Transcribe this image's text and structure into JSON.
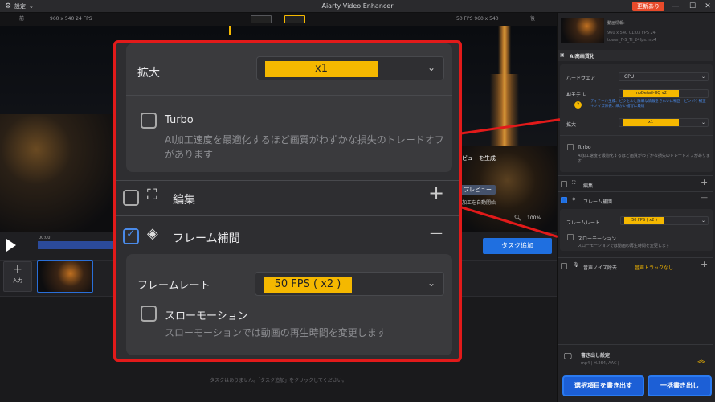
{
  "titlebar": {
    "settings": "設定",
    "title": "Aiarty Video Enhancer",
    "update": "更新あり",
    "minimize": "—",
    "maximize": "☐",
    "close": "✕"
  },
  "preview": {
    "before": "前",
    "after": "後",
    "src_info": "960 x 540  24 FPS",
    "dst_info": "50 FPS  960 x 540",
    "generate": "ビューを生成",
    "preview_btn": "プレビュー",
    "auto_process": "加工を自動開始",
    "zoom": "100%",
    "time": "00:00"
  },
  "clips": {
    "add": "入力",
    "add_icon": "+"
  },
  "tasks": {
    "task_add": "タスク追加",
    "empty": "タスクはありません。「タスク追加」をクリックしてください。"
  },
  "right": {
    "file_title": "動画情報:",
    "file_meta": "960 x 540  01:03  FPS 24",
    "file_name": "tower_F-S_TI_24fps.mp4",
    "ai_section": "AI高画質化",
    "hardware_label": "ハードウェア",
    "hardware_value": "CPU",
    "model_label": "AIモデル",
    "model_value": "moDetail-HQ  v2",
    "model_desc": "ディテール生成、ビクセルと詳細な情報をきれいに補正　ピンボケ補正＋ノイズ除去、細かい描写に最適",
    "scale_label": "拡大",
    "scale_value": "x1",
    "turbo_label": "Turbo",
    "turbo_desc": "AI加工速度を最適化するほど画質がわずかな損失のトレードオフがあります",
    "edit_label": "編集",
    "frame_label": "フレーム補間",
    "fr_label": "フレームレート",
    "fr_value": "50 FPS ( x2 )",
    "slow_label": "スローモーション",
    "slow_desc": "スローモーションでは動画の再生時間を変更します",
    "noise_label": "音声ノイズ除去",
    "noise_value": "音声トラックなし",
    "export_title": "書き出し設定",
    "export_meta": "mp4 | H.264, AAC |",
    "export_selected": "選択項目を書き出す",
    "export_all": "一括書き出し"
  },
  "zoom": {
    "scale_label": "拡大",
    "scale_value": "x1",
    "turbo_label": "Turbo",
    "turbo_desc": "AI加工速度を最適化するほど画質がわずかな損失のトレードオフがあります",
    "edit_label": "編集",
    "edit_toggle": "+",
    "frame_label": "フレーム補間",
    "frame_toggle": "—",
    "fr_label": "フレームレート",
    "fr_value": "50 FPS ( x2 )",
    "slow_label": "スローモーション",
    "slow_desc": "スローモーションでは動画の再生時間を変更します"
  },
  "colors": {
    "accent": "#f5b800",
    "primary": "#1f6fe0",
    "callout": "#e21a1a",
    "update": "#e84a2a"
  }
}
